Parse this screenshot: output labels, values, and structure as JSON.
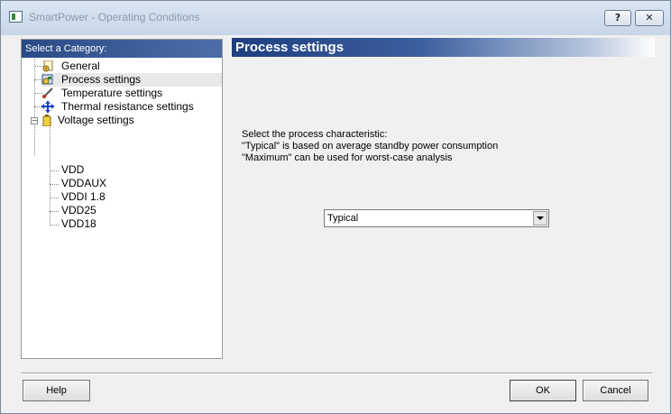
{
  "window": {
    "title": "SmartPower - Operating Conditions",
    "help_button": "?",
    "close_button": "✕"
  },
  "sidebar": {
    "header": "Select a Category:",
    "items": [
      {
        "label": "General",
        "icon": "gear-document-icon"
      },
      {
        "label": "Process settings",
        "icon": "process-chip-icon",
        "selected": true
      },
      {
        "label": "Temperature settings",
        "icon": "thermometer-icon"
      },
      {
        "label": "Thermal resistance settings",
        "icon": "arrows-cross-icon"
      },
      {
        "label": "Voltage settings",
        "icon": "battery-icon",
        "expanded": true,
        "children": [
          "VDD",
          "VDDAUX",
          "VDDI 1.8",
          "VDD25",
          "VDD18"
        ]
      }
    ],
    "expander": "−"
  },
  "main": {
    "title": "Process settings",
    "description": [
      "Select the process characteristic:",
      " \"Typical\" is based on average standby power consumption",
      " \"Maximum\" can be used for worst-case analysis"
    ],
    "process_select": {
      "value": "Typical"
    }
  },
  "buttons": {
    "help": "Help",
    "ok": "OK",
    "cancel": "Cancel"
  },
  "colors": {
    "header_blue": "#2a4a86",
    "selection": "#e8e8e8"
  }
}
